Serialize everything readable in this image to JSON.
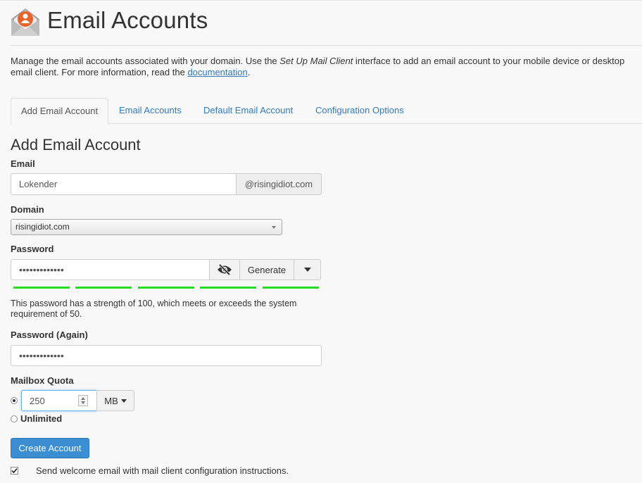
{
  "header": {
    "title": "Email Accounts",
    "icon": "email-accounts-icon"
  },
  "description": {
    "part1": "Manage the email accounts associated with your domain. Use the ",
    "emphasis": "Set Up Mail Client",
    "part2": " interface to add an email account to your mobile device or desktop email client. For more information, read the ",
    "link": "documentation",
    "part3": "."
  },
  "tabs": [
    {
      "label": "Add Email Account",
      "active": true
    },
    {
      "label": "Email Accounts",
      "active": false
    },
    {
      "label": "Default Email Account",
      "active": false
    },
    {
      "label": "Configuration Options",
      "active": false
    }
  ],
  "form": {
    "title": "Add Email Account",
    "email": {
      "label": "Email",
      "value": "Lokender",
      "suffix": "@risingidiot.com"
    },
    "domain": {
      "label": "Domain",
      "value": "risingidiot.com"
    },
    "password": {
      "label": "Password",
      "value": "•••••••••••••",
      "generate_label": "Generate",
      "strength": 100,
      "help": "This password has a strength of 100, which meets or exceeds the system requirement of 50."
    },
    "password_again": {
      "label": "Password (Again)",
      "value": "•••••••••••••"
    },
    "quota": {
      "label": "Mailbox Quota",
      "value": "250",
      "unit": "MB",
      "unlimited_label": "Unlimited",
      "selected": "limited"
    },
    "submit_label": "Create Account",
    "welcome_email": {
      "label": "Send welcome email with mail client configuration instructions.",
      "checked": true
    }
  },
  "colors": {
    "accent": "#337ab7",
    "primary_button": "#3a8ed1",
    "strength_bar": "#22dd22",
    "icon_orange": "#e8632a"
  }
}
